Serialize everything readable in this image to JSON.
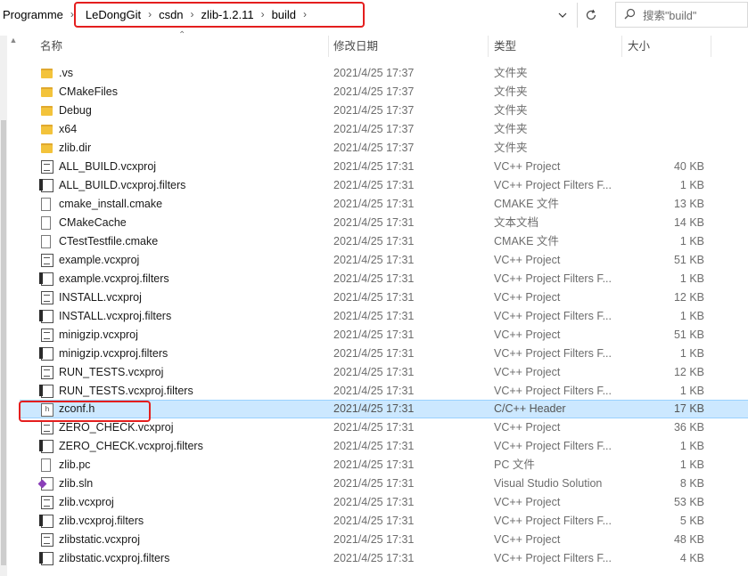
{
  "address": {
    "lead": "Programme",
    "crumbs": [
      "LeDongGit",
      "csdn",
      "zlib-1.2.11",
      "build"
    ],
    "separator": "›",
    "dropdown_icon": "chevron-down-icon",
    "refresh_icon": "refresh-icon",
    "search_placeholder": "搜索\"build\""
  },
  "columns": {
    "name": "名称",
    "date": "修改日期",
    "type": "类型",
    "size": "大小"
  },
  "files": [
    {
      "name": ".vs",
      "date": "2021/4/25 17:37",
      "type": "文件夹",
      "size": "",
      "icon": "folder-icon"
    },
    {
      "name": "CMakeFiles",
      "date": "2021/4/25 17:37",
      "type": "文件夹",
      "size": "",
      "icon": "folder-icon"
    },
    {
      "name": "Debug",
      "date": "2021/4/25 17:37",
      "type": "文件夹",
      "size": "",
      "icon": "folder-icon"
    },
    {
      "name": "x64",
      "date": "2021/4/25 17:37",
      "type": "文件夹",
      "size": "",
      "icon": "folder-icon"
    },
    {
      "name": "zlib.dir",
      "date": "2021/4/25 17:37",
      "type": "文件夹",
      "size": "",
      "icon": "folder-icon"
    },
    {
      "name": "ALL_BUILD.vcxproj",
      "date": "2021/4/25 17:31",
      "type": "VC++ Project",
      "size": "40 KB",
      "icon": "vcxproj-icon"
    },
    {
      "name": "ALL_BUILD.vcxproj.filters",
      "date": "2021/4/25 17:31",
      "type": "VC++ Project Filters F...",
      "size": "1 KB",
      "icon": "filters-icon"
    },
    {
      "name": "cmake_install.cmake",
      "date": "2021/4/25 17:31",
      "type": "CMAKE 文件",
      "size": "13 KB",
      "icon": "document-icon"
    },
    {
      "name": "CMakeCache",
      "date": "2021/4/25 17:31",
      "type": "文本文档",
      "size": "14 KB",
      "icon": "document-icon"
    },
    {
      "name": "CTestTestfile.cmake",
      "date": "2021/4/25 17:31",
      "type": "CMAKE 文件",
      "size": "1 KB",
      "icon": "document-icon"
    },
    {
      "name": "example.vcxproj",
      "date": "2021/4/25 17:31",
      "type": "VC++ Project",
      "size": "51 KB",
      "icon": "vcxproj-icon"
    },
    {
      "name": "example.vcxproj.filters",
      "date": "2021/4/25 17:31",
      "type": "VC++ Project Filters F...",
      "size": "1 KB",
      "icon": "filters-icon"
    },
    {
      "name": "INSTALL.vcxproj",
      "date": "2021/4/25 17:31",
      "type": "VC++ Project",
      "size": "12 KB",
      "icon": "vcxproj-icon"
    },
    {
      "name": "INSTALL.vcxproj.filters",
      "date": "2021/4/25 17:31",
      "type": "VC++ Project Filters F...",
      "size": "1 KB",
      "icon": "filters-icon"
    },
    {
      "name": "minigzip.vcxproj",
      "date": "2021/4/25 17:31",
      "type": "VC++ Project",
      "size": "51 KB",
      "icon": "vcxproj-icon"
    },
    {
      "name": "minigzip.vcxproj.filters",
      "date": "2021/4/25 17:31",
      "type": "VC++ Project Filters F...",
      "size": "1 KB",
      "icon": "filters-icon"
    },
    {
      "name": "RUN_TESTS.vcxproj",
      "date": "2021/4/25 17:31",
      "type": "VC++ Project",
      "size": "12 KB",
      "icon": "vcxproj-icon"
    },
    {
      "name": "RUN_TESTS.vcxproj.filters",
      "date": "2021/4/25 17:31",
      "type": "VC++ Project Filters F...",
      "size": "1 KB",
      "icon": "filters-icon"
    },
    {
      "name": "zconf.h",
      "date": "2021/4/25 17:31",
      "type": "C/C++ Header",
      "size": "17 KB",
      "icon": "header-file-icon",
      "selected": true
    },
    {
      "name": "ZERO_CHECK.vcxproj",
      "date": "2021/4/25 17:31",
      "type": "VC++ Project",
      "size": "36 KB",
      "icon": "vcxproj-icon"
    },
    {
      "name": "ZERO_CHECK.vcxproj.filters",
      "date": "2021/4/25 17:31",
      "type": "VC++ Project Filters F...",
      "size": "1 KB",
      "icon": "filters-icon"
    },
    {
      "name": "zlib.pc",
      "date": "2021/4/25 17:31",
      "type": "PC 文件",
      "size": "1 KB",
      "icon": "document-icon"
    },
    {
      "name": "zlib.sln",
      "date": "2021/4/25 17:31",
      "type": "Visual Studio Solution",
      "size": "8 KB",
      "icon": "solution-icon"
    },
    {
      "name": "zlib.vcxproj",
      "date": "2021/4/25 17:31",
      "type": "VC++ Project",
      "size": "53 KB",
      "icon": "vcxproj-icon"
    },
    {
      "name": "zlib.vcxproj.filters",
      "date": "2021/4/25 17:31",
      "type": "VC++ Project Filters F...",
      "size": "5 KB",
      "icon": "filters-icon"
    },
    {
      "name": "zlibstatic.vcxproj",
      "date": "2021/4/25 17:31",
      "type": "VC++ Project",
      "size": "48 KB",
      "icon": "vcxproj-icon"
    },
    {
      "name": "zlibstatic.vcxproj.filters",
      "date": "2021/4/25 17:31",
      "type": "VC++ Project Filters F...",
      "size": "4 KB",
      "icon": "filters-icon"
    }
  ],
  "colors": {
    "annotation_red": "#e41e1e",
    "selection_bg": "#cce8ff",
    "folder": "#f3c33b"
  }
}
